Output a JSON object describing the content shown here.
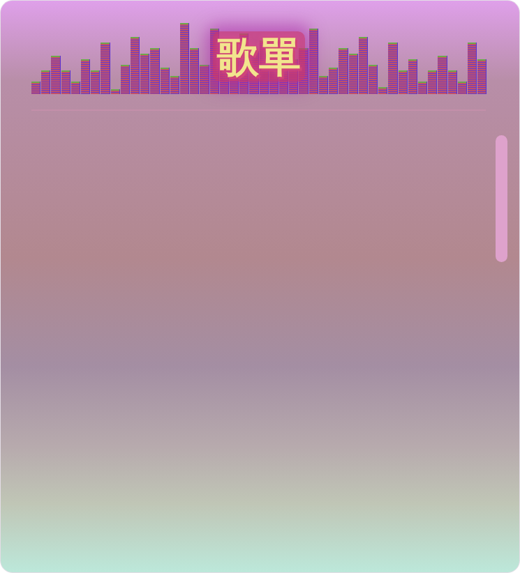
{
  "header": {
    "title": "歌單"
  },
  "equalizer": {
    "levels": [
      0.16,
      0.32,
      0.53,
      0.32,
      0.16,
      0.48,
      0.32,
      0.72,
      0.05,
      0.4,
      0.8,
      0.56,
      0.64,
      0.36,
      0.24,
      1.0,
      0.64,
      0.4,
      0.92,
      0.7,
      0.5,
      0.85,
      0.6,
      0.75,
      0.45,
      0.55,
      0.48,
      0.64,
      0.92,
      0.24,
      0.36,
      0.64,
      0.56,
      0.8,
      0.4,
      0.08,
      0.72,
      0.32,
      0.48,
      0.16,
      0.32,
      0.53,
      0.32,
      0.16,
      0.72,
      0.48
    ]
  },
  "playlist": {
    "items": []
  },
  "scrollbar": {
    "level": 0.3
  }
}
